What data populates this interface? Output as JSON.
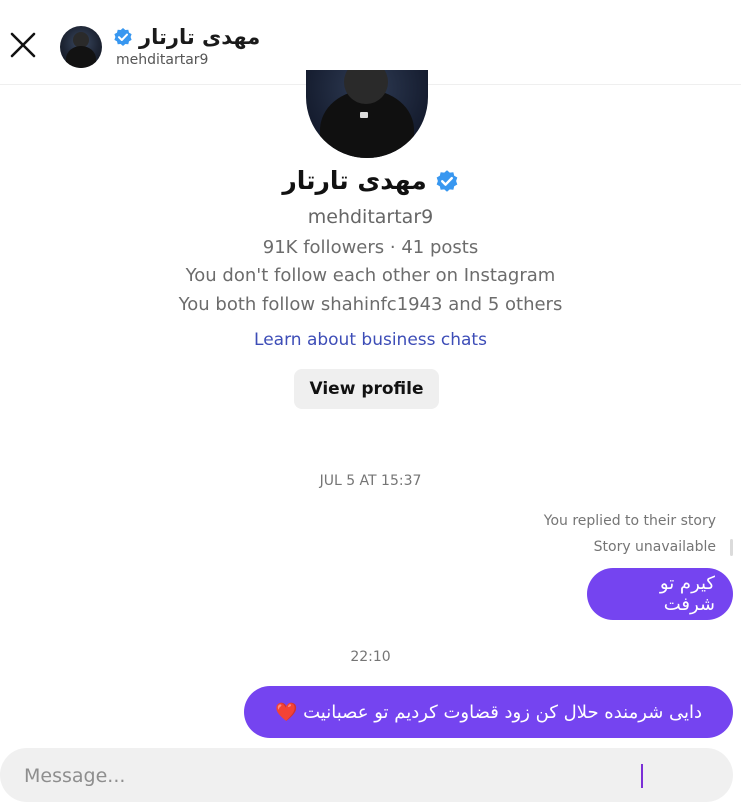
{
  "header": {
    "name": "مهدی تارتار",
    "username": "mehditartar9"
  },
  "profile": {
    "name": "مهدی تارتار",
    "username": "mehditartar9",
    "stats": "91K followers · 41 posts",
    "follow_status": "You don't follow each other on Instagram",
    "mutual": "You both follow shahinfc1943 and 5 others",
    "learn_link": "Learn about business chats",
    "view_profile_label": "View profile"
  },
  "conversation": {
    "timestamp_1": "JUL 5 AT 15:37",
    "story_reply_note": "You replied to their story",
    "story_status": "Story unavailable",
    "message_1": "کیرم تو شرفت",
    "timestamp_2": "22:10",
    "message_2": "دایی شرمنده حلال کن زود قضاوت کردیم تو عصبانیت ❤️"
  },
  "composer": {
    "placeholder": "Message..."
  },
  "colors": {
    "bubble": "#7544f0",
    "verified": "#3897f0",
    "link": "#3d4db7"
  },
  "icons": [
    "close-icon",
    "verified-badge-icon"
  ]
}
